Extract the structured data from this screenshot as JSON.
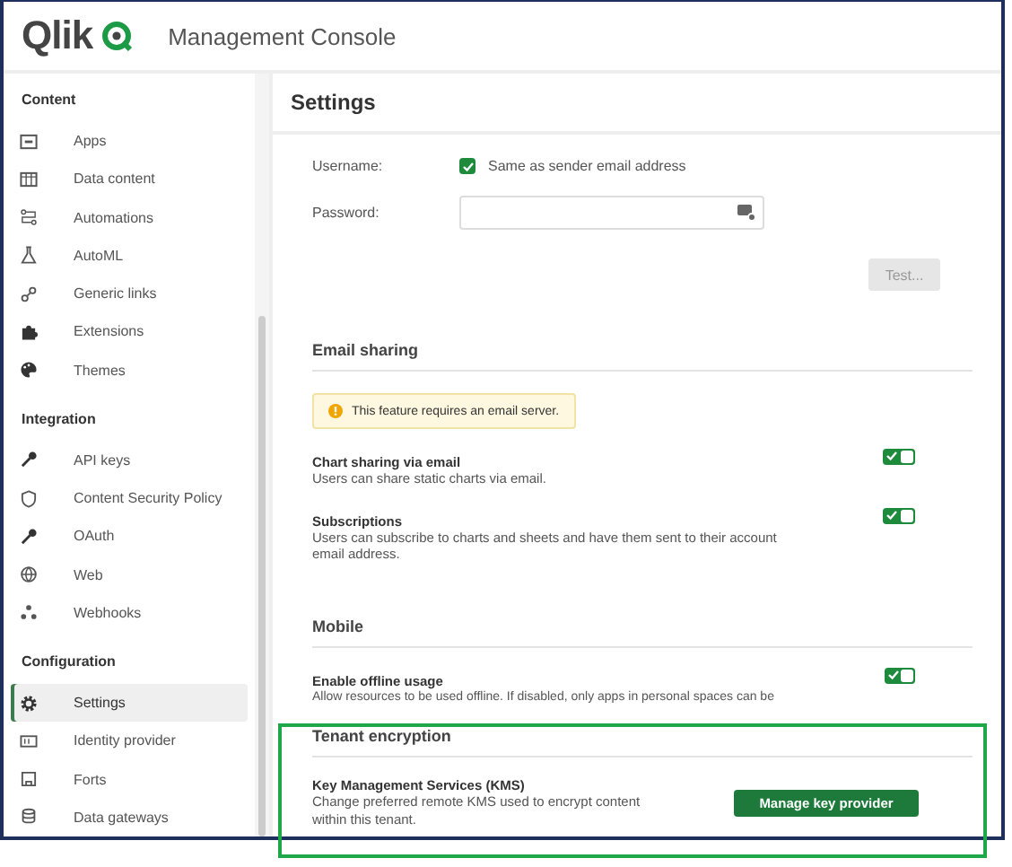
{
  "header": {
    "logo": "Qlik",
    "title": "Management Console"
  },
  "sidebar": {
    "groups": [
      {
        "heading": "Content",
        "items": [
          {
            "label": "Apps",
            "selected": false
          },
          {
            "label": "Data content",
            "selected": false
          },
          {
            "label": "Automations",
            "selected": false
          },
          {
            "label": "AutoML",
            "selected": false
          },
          {
            "label": "Generic links",
            "selected": false
          },
          {
            "label": "Extensions",
            "selected": false
          },
          {
            "label": "Themes",
            "selected": false
          }
        ]
      },
      {
        "heading": "Integration",
        "items": [
          {
            "label": "API keys",
            "selected": false
          },
          {
            "label": "Content Security Policy",
            "selected": false
          },
          {
            "label": "OAuth",
            "selected": false
          },
          {
            "label": "Web",
            "selected": false
          },
          {
            "label": "Webhooks",
            "selected": false
          }
        ]
      },
      {
        "heading": "Configuration",
        "items": [
          {
            "label": "Settings",
            "selected": true
          },
          {
            "label": "Identity provider",
            "selected": false
          },
          {
            "label": "Forts",
            "selected": false
          },
          {
            "label": "Data gateways",
            "selected": false
          }
        ]
      }
    ]
  },
  "page_title": "Settings",
  "username": {
    "label": "Username:",
    "checkbox_label": "Same as sender email address",
    "checked": true
  },
  "password": {
    "label": "Password:"
  },
  "test_button": {
    "label": "Test...",
    "disabled": true
  },
  "sections": [
    {
      "heading": "Email sharing",
      "notice": "This feature requires an email server.",
      "rows": [
        {
          "title": "Chart sharing via email",
          "description": "Users can share static charts via email.",
          "on": true
        },
        {
          "title": "Subscriptions",
          "description": "Users can subscribe to charts and sheets and have them sent to their account email address.",
          "on": true
        }
      ]
    },
    {
      "heading": "Mobile",
      "rows": [
        {
          "title": "Enable offline usage",
          "description": "Allow resources to be used offline. If disabled, only apps in personal spaces can be",
          "on": true
        }
      ]
    }
  ],
  "tenant_encryption": {
    "heading": "Tenant encryption",
    "title": "Key Management Services (KMS)",
    "description": "Change preferred remote KMS used to encrypt content within this tenant.",
    "button": "Manage key provider"
  }
}
